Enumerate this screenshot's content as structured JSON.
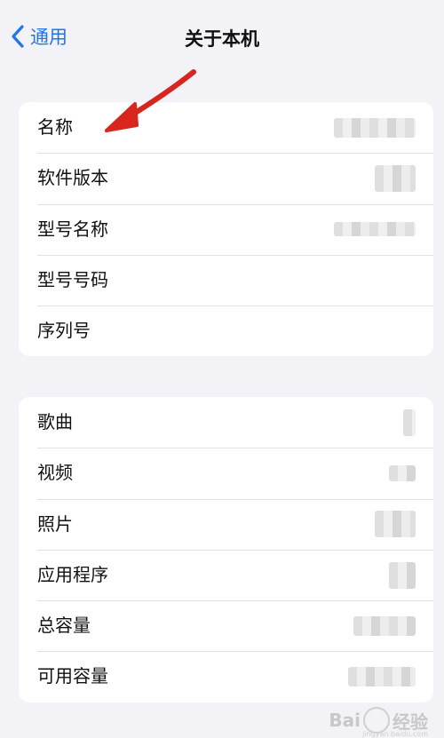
{
  "nav": {
    "back_label": "通用",
    "title": "关于本机"
  },
  "group1": [
    {
      "label": "名称"
    },
    {
      "label": "软件版本"
    },
    {
      "label": "型号名称"
    },
    {
      "label": "型号号码"
    },
    {
      "label": "序列号"
    }
  ],
  "group2": [
    {
      "label": "歌曲"
    },
    {
      "label": "视频"
    },
    {
      "label": "照片"
    },
    {
      "label": "应用程序"
    },
    {
      "label": "总容量"
    },
    {
      "label": "可用容量"
    }
  ],
  "watermark": {
    "brand_left": "Bai",
    "brand_right": "经验",
    "sub": "jingyan.baidu.com"
  },
  "colors": {
    "accent": "#1c76f2",
    "annotation_arrow": "#d9261c",
    "background": "#f2f2f7"
  },
  "icons": {
    "back": "chevron-left-icon",
    "annotation": "red-arrow-icon",
    "watermark": "baidu-paw-icon"
  }
}
